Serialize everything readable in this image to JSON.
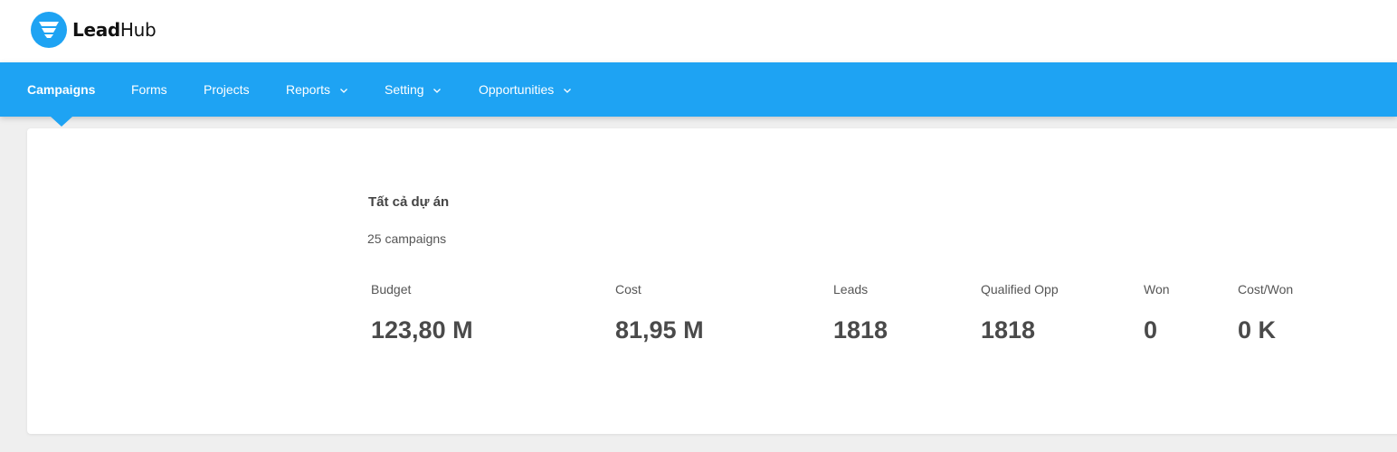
{
  "brand": {
    "name_bold": "Lead",
    "name_regular": "Hub",
    "icon": "funnel-icon",
    "color": "#1ea3f3"
  },
  "nav": {
    "items": [
      {
        "label": "Campaigns",
        "active": true,
        "has_dropdown": false
      },
      {
        "label": "Forms",
        "active": false,
        "has_dropdown": false
      },
      {
        "label": "Projects",
        "active": false,
        "has_dropdown": false
      },
      {
        "label": "Reports",
        "active": false,
        "has_dropdown": true
      },
      {
        "label": "Setting",
        "active": false,
        "has_dropdown": true
      },
      {
        "label": "Opportunities",
        "active": false,
        "has_dropdown": true
      }
    ],
    "background": "#1ea3f3"
  },
  "summary": {
    "project_title": "Tất cả dự án",
    "campaign_count": "25 campaigns",
    "stats": [
      {
        "label": "Budget",
        "value": "123,80 M"
      },
      {
        "label": "Cost",
        "value": "81,95 M"
      },
      {
        "label": "Leads",
        "value": "1818"
      },
      {
        "label": "Qualified Opp",
        "value": "1818"
      },
      {
        "label": "Won",
        "value": "0"
      },
      {
        "label": "Cost/Won",
        "value": "0 K"
      }
    ]
  }
}
